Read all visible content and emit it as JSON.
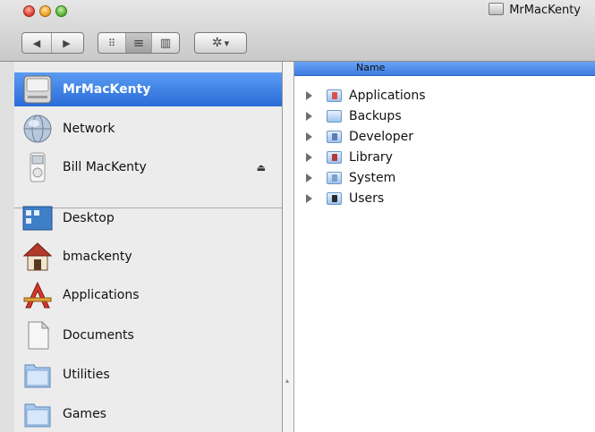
{
  "window": {
    "title": "MrMacKenty"
  },
  "toolbar": {
    "back": "◀",
    "forward": "▶",
    "view_icon": "⠿",
    "view_list": "≡",
    "view_column": "▥",
    "action": "✲",
    "action_arrow": "▾"
  },
  "sidebar": {
    "devices": [
      {
        "label": "MrMacKenty",
        "icon": "hard-drive-icon",
        "selected": true
      },
      {
        "label": "Network",
        "icon": "network-globe-icon"
      },
      {
        "label": "Bill MacKenty",
        "icon": "ipod-icon",
        "eject": "⏏"
      }
    ],
    "places": [
      {
        "label": "Desktop",
        "icon": "desktop-icon"
      },
      {
        "label": "bmackenty",
        "icon": "home-icon"
      },
      {
        "label": "Applications",
        "icon": "applications-icon"
      },
      {
        "label": "Documents",
        "icon": "documents-icon"
      },
      {
        "label": "Utilities",
        "icon": "folder-icon"
      },
      {
        "label": "Games",
        "icon": "folder-icon"
      }
    ]
  },
  "list": {
    "column_header": "Name",
    "items": [
      {
        "name": "Applications",
        "badge_color": "#d9534f"
      },
      {
        "name": "Backups",
        "badge_color": ""
      },
      {
        "name": "Developer",
        "badge_color": "#5b7fb3"
      },
      {
        "name": "Library",
        "badge_color": "#b23a3a"
      },
      {
        "name": "System",
        "badge_color": "#7aa0c8"
      },
      {
        "name": "Users",
        "badge_color": "#2a2a2a"
      }
    ]
  },
  "colors": {
    "selection": "#3a78dc",
    "header": "#5b95ee"
  }
}
